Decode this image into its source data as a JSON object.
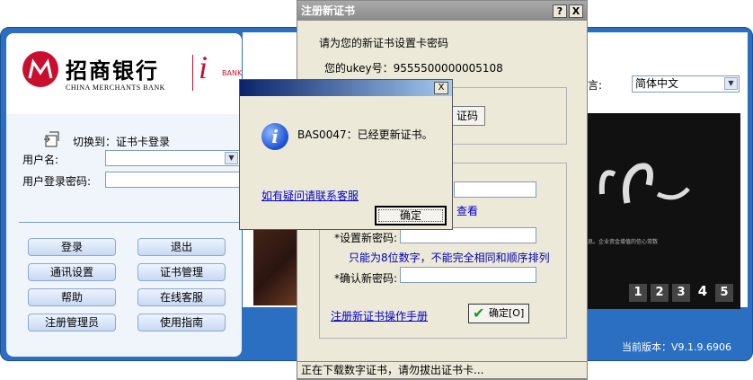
{
  "main": {
    "logo_cn": "招商银行",
    "logo_en": "CHINA MERCHANTS BANK",
    "logo_ibank": "i",
    "logo_bank": "BANK",
    "switch_text": "切换到：证书卡登录",
    "user_label": "用户名:",
    "user_value": "",
    "pwd_label": "用户登录密码:",
    "buttons": {
      "login": "登录",
      "exit": "退出",
      "comm_settings": "通讯设置",
      "cert_manage": "证书管理",
      "help": "帮助",
      "online_service": "在线客服",
      "reg_admin": "注册管理员",
      "guide": "使用指南"
    },
    "lang_label": "言:",
    "lang_value": "简体中文",
    "slogan": "息。企业资金增值的信心常数",
    "pages": [
      "1",
      "2",
      "3",
      "4",
      "5"
    ],
    "active_page": "4",
    "version": "当前版本：V9.1.9.6906"
  },
  "register": {
    "title": "注册新证书",
    "help_btn": "?",
    "close_btn": "X",
    "prompt": "请为您的新证书设置卡密码",
    "ukey_line": "您的ukey号：9555500000005108",
    "partial_btn": "证码",
    "view_link": "查看",
    "new_pwd_label": "*设置新密码:",
    "hint": "只能为8位数字，不能完全相同和顺序排列",
    "confirm_label": "*确认新密码:",
    "manual_link": "注册新证书操作手册",
    "ok_btn": "确定[O]",
    "status": "正在下载数字证书，请勿拔出证书卡..."
  },
  "msgbox": {
    "close_btn": "X",
    "icon_glyph": "i",
    "message": "BAS0047：已经更新证书。",
    "link": "如有疑问请联系客服",
    "ok": "确定"
  },
  "colors": {
    "brand_red": "#c8102e",
    "frame_blue": "#2a6fc1",
    "dialog_bg": "#ece9d8",
    "link_blue": "#0000cc"
  }
}
